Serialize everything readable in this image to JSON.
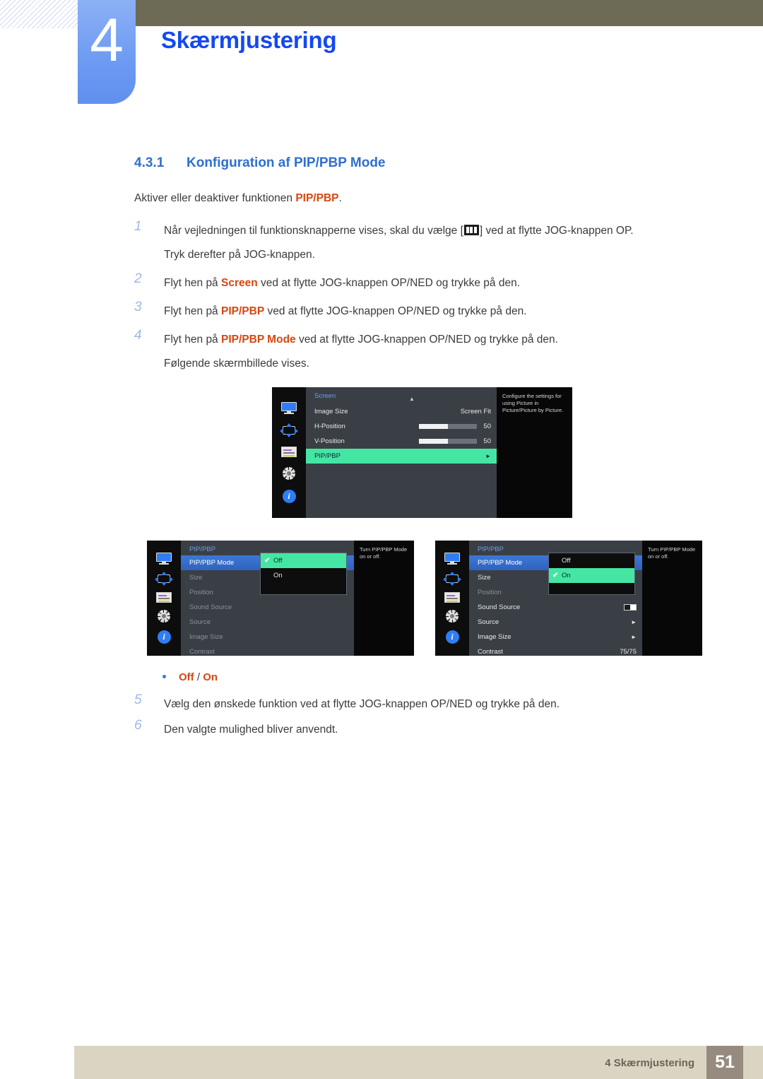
{
  "header": {
    "chapter_number": "4",
    "chapter_title": "Skærmjustering"
  },
  "section": {
    "number": "4.3.1",
    "title": "Konfiguration af PIP/PBP Mode",
    "intro_before": "Aktiver eller deaktiver funktionen ",
    "intro_term": "PIP/PBP",
    "intro_after": "."
  },
  "steps": [
    {
      "num": "1",
      "text_a": "Når vejledningen til funktionsknapperne vises, skal du vælge [",
      "text_b": "] ved at flytte JOG-knappen OP.",
      "text_second": "Tryk derefter på JOG-knappen."
    },
    {
      "num": "2",
      "text_a": "Flyt hen på ",
      "term": "Screen",
      "text_b": " ved at flytte JOG-knappen OP/NED og trykke på den."
    },
    {
      "num": "3",
      "text_a": "Flyt hen på ",
      "term": "PIP/PBP",
      "text_b": " ved at flytte JOG-knappen OP/NED og trykke på den."
    },
    {
      "num": "4",
      "text_a": "Flyt hen på ",
      "term": "PIP/PBP Mode",
      "text_b": " ved at flytte JOG-knappen OP/NED og trykke på den.",
      "text_second": "Følgende skærmbillede vises."
    }
  ],
  "osd_screen": {
    "title": "Screen",
    "caret": "▲",
    "help": "Configure the settings for using Picture in Picture/Picture by Picture.",
    "rows": [
      {
        "label": "Image Size",
        "value": "Screen Fit",
        "type": "value"
      },
      {
        "label": "H-Position",
        "value": "50",
        "type": "slider",
        "fill": 50
      },
      {
        "label": "V-Position",
        "value": "50",
        "type": "slider",
        "fill": 50
      },
      {
        "label": "PIP/PBP",
        "value": "►",
        "type": "highlight-green"
      }
    ],
    "rail_icons": [
      "monitor-icon",
      "position-icon",
      "osd-icon",
      "gear-icon",
      "info-icon"
    ]
  },
  "osd_off": {
    "title": "PIP/PBP",
    "help": "Turn PIP/PBP Mode on or off.",
    "rows": [
      {
        "label": "PIP/PBP Mode",
        "value": "",
        "state": "selected"
      },
      {
        "label": "Size",
        "value": "",
        "state": "dim"
      },
      {
        "label": "Position",
        "value": "",
        "state": "dim"
      },
      {
        "label": "Sound Source",
        "value": "",
        "state": "dim"
      },
      {
        "label": "Source",
        "value": "",
        "state": "dim"
      },
      {
        "label": "Image Size",
        "value": "",
        "state": "dim"
      },
      {
        "label": "Contrast",
        "value": "",
        "state": "dim"
      }
    ],
    "popup": {
      "options": [
        {
          "label": "Off",
          "selected": true,
          "check": "✔"
        },
        {
          "label": "On",
          "selected": false,
          "check": ""
        }
      ]
    }
  },
  "osd_on": {
    "title": "PIP/PBP",
    "help": "Turn PIP/PBP Mode on or off.",
    "rows": [
      {
        "label": "PIP/PBP Mode",
        "value": "",
        "state": "selected"
      },
      {
        "label": "Size",
        "value": "",
        "state": "normal"
      },
      {
        "label": "Position",
        "value": "",
        "state": "dim"
      },
      {
        "label": "Sound Source",
        "value": "toggle",
        "state": "normal"
      },
      {
        "label": "Source",
        "value": "►",
        "state": "normal"
      },
      {
        "label": "Image Size",
        "value": "►",
        "state": "normal"
      },
      {
        "label": "Contrast",
        "value": "75/75",
        "state": "normal"
      }
    ],
    "popup": {
      "options": [
        {
          "label": "Off",
          "selected": false,
          "check": ""
        },
        {
          "label": "On",
          "selected": true,
          "check": "✔"
        }
      ]
    }
  },
  "bullet": {
    "off": "Off",
    "separator": " / ",
    "on": "On"
  },
  "steps2": [
    {
      "num": "5",
      "text": "Vælg den ønskede funktion ved at flytte JOG-knappen OP/NED og trykke på den."
    },
    {
      "num": "6",
      "text": "Den valgte mulighed bliver anvendt."
    }
  ],
  "footer": {
    "text": "4 Skærmjustering",
    "page": "51"
  },
  "colors": {
    "accent_blue": "#1449f0",
    "section_blue": "#2f6fd0",
    "orange": "#d9460f",
    "olive": "#6d6b56",
    "tab_blue": "#6f9cf2",
    "green_highlight": "#45e6a4",
    "footer_bg": "#dad4c2",
    "footer_page_bg": "#968b7e"
  }
}
